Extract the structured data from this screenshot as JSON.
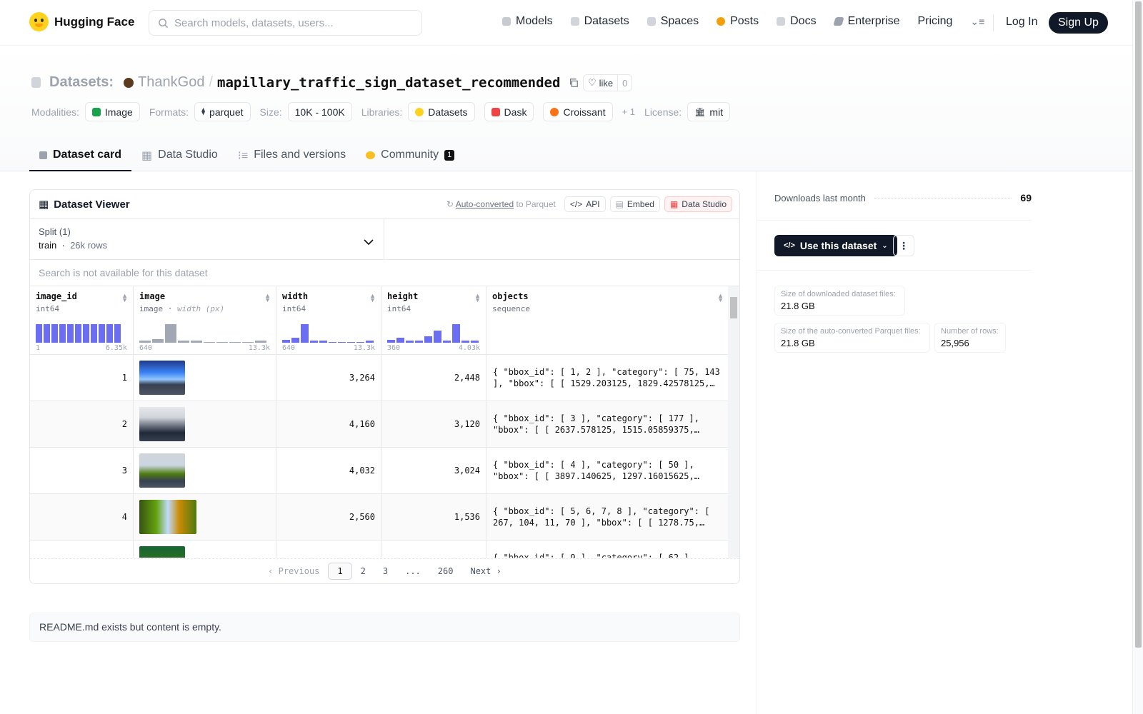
{
  "header": {
    "brand": "Hugging Face",
    "search_placeholder": "Search models, datasets, users...",
    "nav": [
      {
        "label": "Models",
        "icon": "models-icon",
        "color": "#6b7280"
      },
      {
        "label": "Datasets",
        "icon": "datasets-icon",
        "color": "#9ca3af"
      },
      {
        "label": "Spaces",
        "icon": "spaces-icon",
        "color": "#9ca3af"
      },
      {
        "label": "Posts",
        "icon": "posts-icon",
        "color": "#f59e0b"
      },
      {
        "label": "Docs",
        "icon": "docs-icon",
        "color": "#9ca3af"
      },
      {
        "label": "Enterprise",
        "icon": "enterprise-icon",
        "color": "#6b7280"
      },
      {
        "label": "Pricing",
        "icon": "",
        "color": ""
      }
    ],
    "login": "Log In",
    "signup": "Sign Up"
  },
  "repo": {
    "type_label": "Datasets:",
    "owner": "ThankGod",
    "name": "mapillary_traffic_sign_dataset_recommended",
    "like_label": "like",
    "like_count": "0",
    "modalities_label": "Modalities:",
    "modalities": [
      "Image"
    ],
    "formats_label": "Formats:",
    "formats": [
      "parquet"
    ],
    "size_label": "Size:",
    "size": "10K - 100K",
    "libraries_label": "Libraries:",
    "libraries": [
      "Datasets",
      "Dask",
      "Croissant"
    ],
    "libraries_more": "+ 1",
    "license_label": "License:",
    "license": "mit"
  },
  "tabs": [
    {
      "label": "Dataset card",
      "active": true
    },
    {
      "label": "Data Studio",
      "active": false
    },
    {
      "label": "Files and versions",
      "active": false
    },
    {
      "label": "Community",
      "active": false,
      "badge": "1"
    }
  ],
  "viewer": {
    "title": "Dataset Viewer",
    "auto_converted": "Auto-converted",
    "to_parquet": "to Parquet",
    "api": "API",
    "embed": "Embed",
    "data_studio": "Data Studio",
    "split_label": "Split (1)",
    "split_value": "train",
    "split_rows": "26k rows",
    "search_disabled": "Search is not available for this dataset",
    "columns": [
      {
        "name": "image_id",
        "type": "int64",
        "min": "1",
        "max": "6.35k",
        "hist": [
          1,
          1,
          1,
          1,
          1,
          1,
          1,
          1,
          1,
          1,
          1
        ]
      },
      {
        "name": "image",
        "type": "image",
        "type_extra": "width (px)",
        "min": "640",
        "max": "13.3k",
        "hist": [
          0.1,
          0.2,
          1,
          0.1,
          0.05,
          0,
          0,
          0,
          0,
          0.05
        ]
      },
      {
        "name": "width",
        "type": "int64",
        "min": "640",
        "max": "13.3k",
        "hist": [
          0.15,
          0.25,
          1,
          0.1,
          0.05,
          0,
          0,
          0,
          0,
          0.05
        ]
      },
      {
        "name": "height",
        "type": "int64",
        "min": "360",
        "max": "4.03k",
        "hist": [
          0.15,
          0.25,
          0.1,
          0.1,
          0.35,
          0.65,
          0.08,
          1,
          0.1,
          0.05
        ]
      },
      {
        "name": "objects",
        "type": "sequence"
      }
    ],
    "rows": [
      {
        "image_id": "1",
        "width": "3,264",
        "height": "2,448",
        "objects": "{ \"bbox_id\": [ 1, 2 ], \"category\": [ 75, 143 ], \"bbox\": [ [ 1529.203125, 1829.42578125,…"
      },
      {
        "image_id": "2",
        "width": "4,160",
        "height": "3,120",
        "objects": "{ \"bbox_id\": [ 3 ], \"category\": [ 177 ], \"bbox\": [ [ 2637.578125, 1515.05859375,…"
      },
      {
        "image_id": "3",
        "width": "4,032",
        "height": "3,024",
        "objects": "{ \"bbox_id\": [ 4 ], \"category\": [ 50 ], \"bbox\": [ [ 3897.140625, 1297.16015625,…"
      },
      {
        "image_id": "4",
        "width": "2,560",
        "height": "1,536",
        "objects": "{ \"bbox_id\": [ 5, 6, 7, 8 ], \"category\": [ 267, 104, 11, 70 ], \"bbox\": [ [ 1278.75,…"
      },
      {
        "image_id": "",
        "width": "",
        "height": "",
        "objects": "{ \"bbox_id\": [ 9 ], \"category\": [ 62 ],"
      }
    ],
    "pager": {
      "prev": "Previous",
      "pages": [
        "1",
        "2",
        "3",
        "...",
        "260"
      ],
      "next": "Next"
    }
  },
  "readme": "README.md exists but content is empty.",
  "sidebar": {
    "downloads_label": "Downloads last month",
    "downloads": "69",
    "use_button": "Use this dataset",
    "stats": [
      {
        "label": "Size of downloaded dataset files:",
        "value": "21.8 GB"
      },
      {
        "label": "Size of the auto-converted Parquet files:",
        "value": "21.8 GB"
      },
      {
        "label": "Number of rows:",
        "value": "25,956"
      }
    ]
  }
}
